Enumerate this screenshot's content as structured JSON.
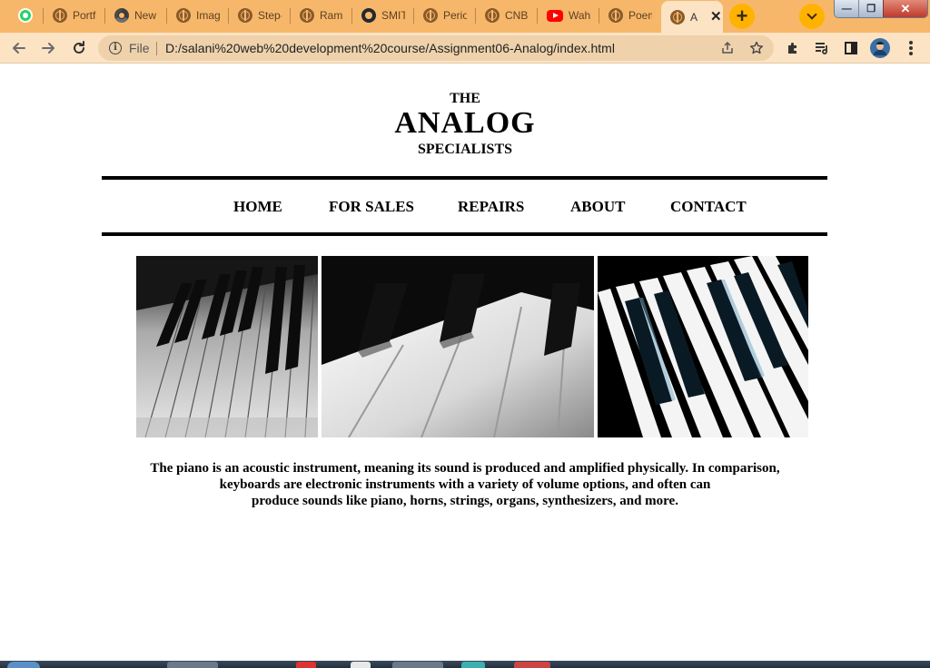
{
  "browser": {
    "tabs": [
      {
        "title": "",
        "icon": "whatsapp-icon"
      },
      {
        "title": "Portfo",
        "icon": "globe-icon"
      },
      {
        "title": "New",
        "icon": "chrome-icon"
      },
      {
        "title": "Imag",
        "icon": "globe-icon"
      },
      {
        "title": "Step-",
        "icon": "globe-icon"
      },
      {
        "title": "Rama",
        "icon": "globe-icon"
      },
      {
        "title": "SMIT",
        "icon": "github-icon"
      },
      {
        "title": "Perio",
        "icon": "globe-icon"
      },
      {
        "title": "CNBC",
        "icon": "globe-icon"
      },
      {
        "title": "Wah",
        "icon": "youtube-icon"
      },
      {
        "title": "Poem",
        "icon": "globe-icon"
      },
      {
        "title": "A",
        "icon": "globe-icon",
        "active": true
      }
    ],
    "new_tab_label": "+",
    "close_label": "✕",
    "window_controls": {
      "minimize": "—",
      "maximize": "❐",
      "close": "✕"
    },
    "address": {
      "scheme_label": "File",
      "url": "D:/salani%20web%20development%20course/Assignment06-Analog/index.html"
    },
    "colors": {
      "tabstrip": "#f7b76a",
      "toolbar": "#fbe3c4",
      "accent": "#ffb300"
    }
  },
  "site": {
    "logo": {
      "top": "THE",
      "main": "ANALOG",
      "sub": "SPECIALISTS"
    },
    "nav": [
      "HOME",
      "FOR SALES",
      "REPAIRS",
      "ABOUT",
      "CONTACT"
    ],
    "images": [
      "piano-keys-photo-1",
      "piano-keys-photo-2",
      "piano-keys-photo-3"
    ],
    "description": [
      "The piano is an acoustic instrument, meaning its sound is produced and amplified physically. In comparison,",
      "keyboards are electronic instruments with a variety of volume options, and often can",
      "produce sounds like piano, horns, strings, organs, synthesizers, and more."
    ]
  }
}
